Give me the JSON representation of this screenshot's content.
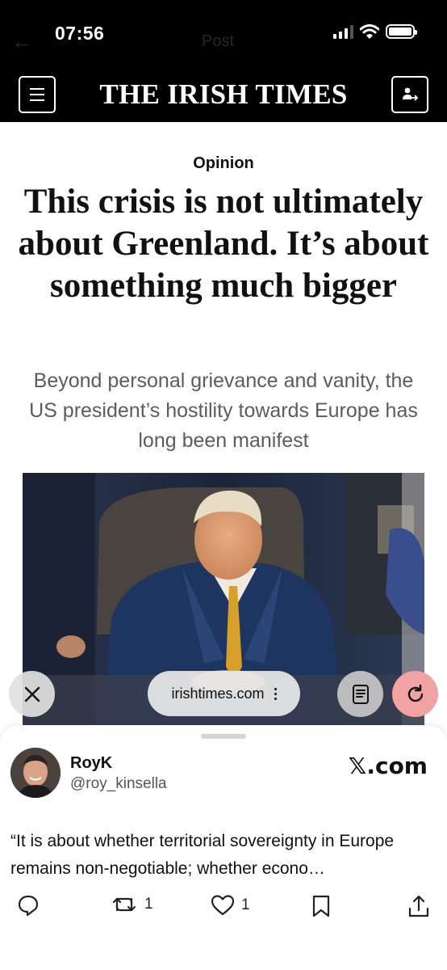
{
  "status_bar": {
    "time": "07:56",
    "ghost_title": "Post"
  },
  "masthead": {
    "title": "THE IRISH TIMES"
  },
  "article": {
    "kicker": "Opinion",
    "headline": "This crisis is not ultimately about Greenland. It’s about something much bigger",
    "standfirst": "Beyond personal grievance and vanity, the US president’s hostility towards Europe has long been manifest"
  },
  "browser": {
    "url": "irishtimes.com"
  },
  "tweet": {
    "author_name": "RoyK",
    "handle": "@roy_kinsella",
    "source": "𝕏.com",
    "text": "“It is about whether territorial sovereignty in Europe remains non-negotiable; whether econo…",
    "retweets": "1",
    "likes": "1"
  },
  "icons": {
    "menu": "hamburger-icon",
    "account": "account-icon",
    "close": "close-icon",
    "url_more": "more-vertical-icon",
    "reader": "reader-mode-icon",
    "reload": "reload-icon",
    "reply": "reply-icon",
    "retweet": "retweet-icon",
    "like": "heart-icon",
    "bookmark": "bookmark-icon",
    "share": "share-icon"
  },
  "colors": {
    "masthead_bg": "#000000",
    "reload_accent": "#f1a3a3",
    "standfirst_text": "#5c5c5c"
  }
}
